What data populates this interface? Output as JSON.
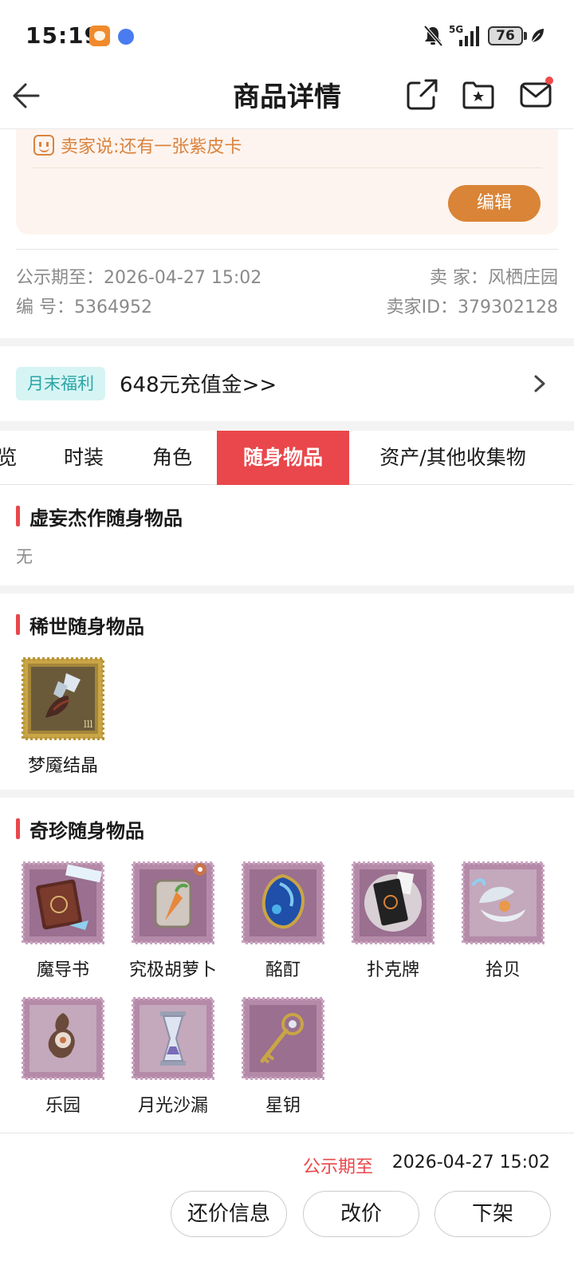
{
  "status_bar": {
    "time": "15:19",
    "network": "5G",
    "battery": "76"
  },
  "nav": {
    "title": "商品详情",
    "icons": [
      "back-arrow-icon",
      "share-icon",
      "folder-star-icon",
      "mail-icon"
    ]
  },
  "seller_note": {
    "text": "卖家说:还有一张紫皮卡",
    "edit_label": "编辑"
  },
  "listing_info": {
    "publish_until": "公示期至：2026-04-27 15:02",
    "seller": "卖 家：风栖庄园",
    "serial": "编 号：5364952",
    "seller_id": "卖家ID：379302128"
  },
  "promo": {
    "tag": "月末福利",
    "text": "648元充值金>>"
  },
  "tabs": [
    {
      "label": "览"
    },
    {
      "label": "时装"
    },
    {
      "label": "角色"
    },
    {
      "label": "随身物品",
      "active": true
    },
    {
      "label": "资产/其他收集物"
    }
  ],
  "sections": {
    "illusion": {
      "title": "虚妄杰作随身物品",
      "empty_text": "无"
    },
    "rare": {
      "title": "稀世随身物品",
      "items": [
        {
          "name": "梦魇结晶",
          "icon": "nightmare-crystal-icon"
        }
      ]
    },
    "treasure": {
      "title": "奇珍随身物品",
      "items": [
        {
          "name": "魔导书",
          "icon": "grimoire-icon"
        },
        {
          "name": "究极胡萝卜",
          "icon": "ultimate-carrot-icon"
        },
        {
          "name": "酩酊",
          "icon": "blue-gem-icon"
        },
        {
          "name": "扑克牌",
          "icon": "poker-card-icon"
        },
        {
          "name": "拾贝",
          "icon": "shell-icon"
        },
        {
          "name": "乐园",
          "icon": "paradise-icon"
        },
        {
          "name": "月光沙漏",
          "icon": "hourglass-icon"
        },
        {
          "name": "星钥",
          "icon": "star-key-icon"
        }
      ]
    }
  },
  "footer": {
    "publish_label": "公示期至",
    "publish_time": "2026-04-27 15:02",
    "buttons": [
      "还价信息",
      "改价",
      "下架"
    ]
  },
  "colors": {
    "accent_red": "#e9474b",
    "edit_orange": "#d98436",
    "promo_teal": "#2aa6a6",
    "rare_stamp_gold": "#c9a545",
    "treasure_stamp_purple": "#b48aa8"
  }
}
